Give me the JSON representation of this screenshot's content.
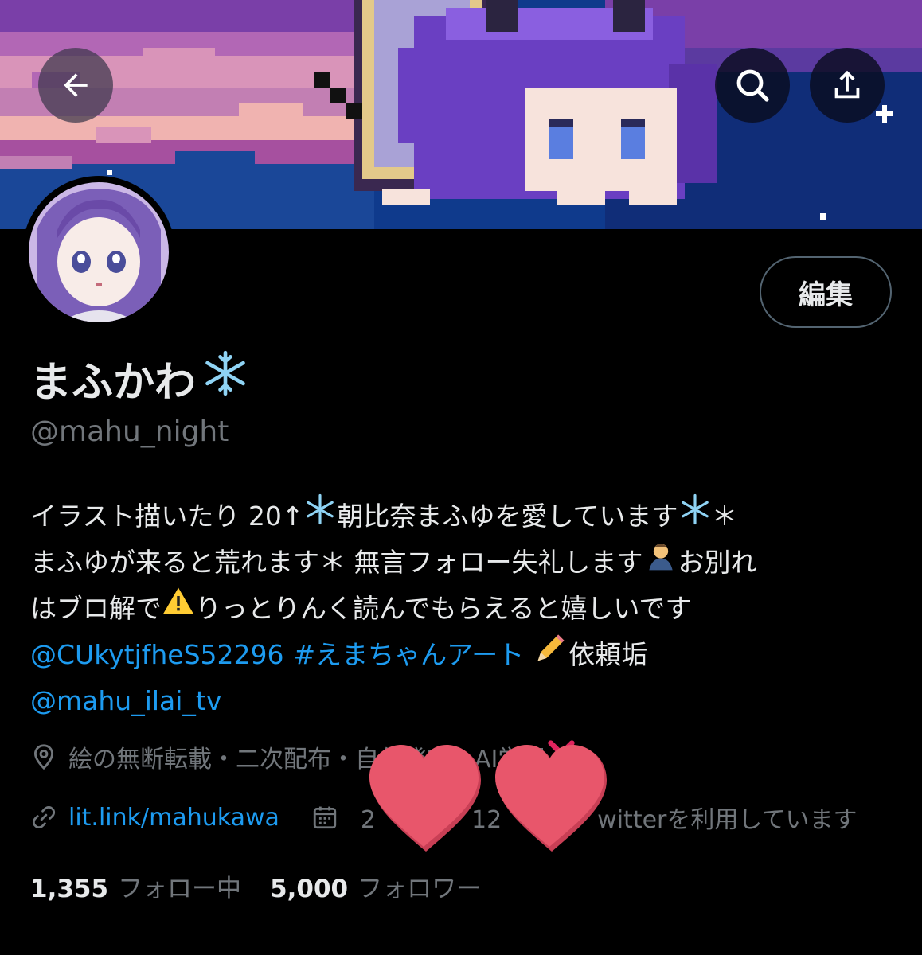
{
  "header": {
    "back_icon": "arrow-left-icon",
    "search_icon": "search-icon",
    "share_icon": "share-upload-icon"
  },
  "profile": {
    "edit_label": "編集",
    "display_name": "まふかわ",
    "display_name_emoji": "snowflake-icon",
    "handle": "@mahu_night"
  },
  "bio": {
    "line1": {
      "t1": "イラスト描いたり 20↑ ",
      "t2": "朝比奈まふゆを愛しています",
      "t3": " ＊"
    },
    "line2": {
      "t1": "まふゆが来ると荒れます＊ 無言フォロー失礼します",
      "t2": " お別れ"
    },
    "line3": {
      "t1": "はブロ解で ",
      "t2": "りっとりんく読んでもらえると嬉しいです"
    },
    "line4": {
      "mention": "@CUkytjfheS52296",
      "hashtag": "#えまちゃんアート",
      "t1": "依頼垢"
    },
    "line5": {
      "mention": "@mahu_ilai_tv"
    }
  },
  "meta": {
    "location_icon": "location-pin-icon",
    "location": "絵の無断転載・二次配布・自作発言・AI学習",
    "location_mark": "cross-mark-icon",
    "link_icon": "link-icon",
    "link": "lit.link/mahukawa",
    "calendar_icon": "calendar-icon",
    "joined": "2　　　　12　　　　witterを利用しています"
  },
  "stats": {
    "following_count": "1,355",
    "following_label": "フォロー中",
    "followers_count": "5,000",
    "followers_label": "フォロワー"
  },
  "colors": {
    "background": "#000000",
    "text": "#e7e9ea",
    "secondary": "#71767b",
    "link": "#1d9bf0",
    "heart": "#e8566b"
  }
}
